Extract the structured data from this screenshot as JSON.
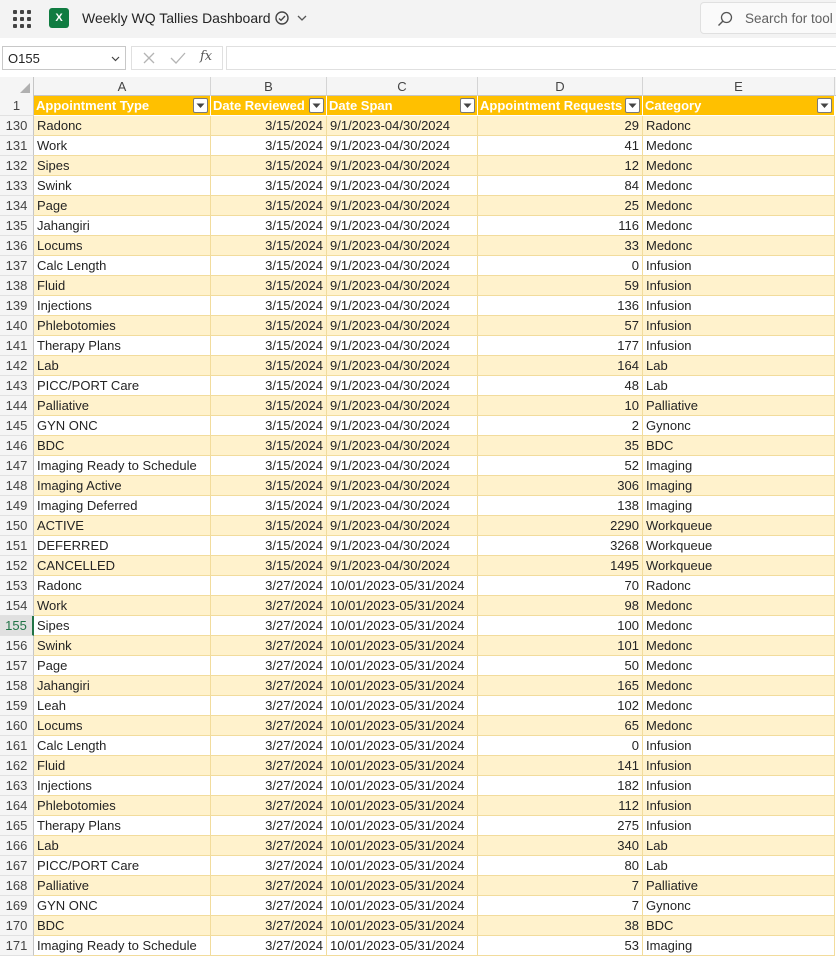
{
  "app": {
    "title": "Weekly WQ Tallies Dashboard",
    "logo_letter": "X",
    "search_placeholder": "Search for tool"
  },
  "formula_bar": {
    "name_box": "O155",
    "formula": ""
  },
  "columns": [
    "A",
    "B",
    "C",
    "D",
    "E"
  ],
  "header_row": {
    "num": "1",
    "cells": [
      "Appointment Type",
      "Date Reviewed",
      "Date Span",
      "Appointment Requests",
      "Category"
    ]
  },
  "rows": [
    {
      "num": "130",
      "cells": [
        "Radonc",
        "3/15/2024",
        "9/1/2023-04/30/2024",
        "29",
        "Radonc"
      ]
    },
    {
      "num": "131",
      "cells": [
        "Work",
        "3/15/2024",
        "9/1/2023-04/30/2024",
        "41",
        "Medonc"
      ]
    },
    {
      "num": "132",
      "cells": [
        "Sipes",
        "3/15/2024",
        "9/1/2023-04/30/2024",
        "12",
        "Medonc"
      ]
    },
    {
      "num": "133",
      "cells": [
        "Swink",
        "3/15/2024",
        "9/1/2023-04/30/2024",
        "84",
        "Medonc"
      ]
    },
    {
      "num": "134",
      "cells": [
        "Page",
        "3/15/2024",
        "9/1/2023-04/30/2024",
        "25",
        "Medonc"
      ]
    },
    {
      "num": "135",
      "cells": [
        "Jahangiri",
        "3/15/2024",
        "9/1/2023-04/30/2024",
        "116",
        "Medonc"
      ]
    },
    {
      "num": "136",
      "cells": [
        "Locums",
        "3/15/2024",
        "9/1/2023-04/30/2024",
        "33",
        "Medonc"
      ]
    },
    {
      "num": "137",
      "cells": [
        "Calc Length",
        "3/15/2024",
        "9/1/2023-04/30/2024",
        "0",
        "Infusion"
      ]
    },
    {
      "num": "138",
      "cells": [
        "Fluid",
        "3/15/2024",
        "9/1/2023-04/30/2024",
        "59",
        "Infusion"
      ]
    },
    {
      "num": "139",
      "cells": [
        "Injections",
        "3/15/2024",
        "9/1/2023-04/30/2024",
        "136",
        "Infusion"
      ]
    },
    {
      "num": "140",
      "cells": [
        "Phlebotomies",
        "3/15/2024",
        "9/1/2023-04/30/2024",
        "57",
        "Infusion"
      ]
    },
    {
      "num": "141",
      "cells": [
        "Therapy Plans",
        "3/15/2024",
        "9/1/2023-04/30/2024",
        "177",
        "Infusion"
      ]
    },
    {
      "num": "142",
      "cells": [
        "Lab",
        "3/15/2024",
        "9/1/2023-04/30/2024",
        "164",
        "Lab"
      ]
    },
    {
      "num": "143",
      "cells": [
        "PICC/PORT Care",
        "3/15/2024",
        "9/1/2023-04/30/2024",
        "48",
        "Lab"
      ]
    },
    {
      "num": "144",
      "cells": [
        "Palliative",
        "3/15/2024",
        "9/1/2023-04/30/2024",
        "10",
        "Palliative"
      ]
    },
    {
      "num": "145",
      "cells": [
        "GYN ONC",
        "3/15/2024",
        "9/1/2023-04/30/2024",
        "2",
        "Gynonc"
      ]
    },
    {
      "num": "146",
      "cells": [
        "BDC",
        "3/15/2024",
        "9/1/2023-04/30/2024",
        "35",
        "BDC"
      ]
    },
    {
      "num": "147",
      "cells": [
        "Imaging Ready to Schedule",
        "3/15/2024",
        "9/1/2023-04/30/2024",
        "52",
        "Imaging"
      ]
    },
    {
      "num": "148",
      "cells": [
        "Imaging Active",
        "3/15/2024",
        "9/1/2023-04/30/2024",
        "306",
        "Imaging"
      ]
    },
    {
      "num": "149",
      "cells": [
        "Imaging Deferred",
        "3/15/2024",
        "9/1/2023-04/30/2024",
        "138",
        "Imaging"
      ]
    },
    {
      "num": "150",
      "cells": [
        "ACTIVE",
        "3/15/2024",
        "9/1/2023-04/30/2024",
        "2290",
        "Workqueue"
      ]
    },
    {
      "num": "151",
      "cells": [
        "DEFERRED",
        "3/15/2024",
        "9/1/2023-04/30/2024",
        "3268",
        "Workqueue"
      ]
    },
    {
      "num": "152",
      "cells": [
        "CANCELLED",
        "3/15/2024",
        "9/1/2023-04/30/2024",
        "1495",
        "Workqueue"
      ]
    },
    {
      "num": "153",
      "cells": [
        "Radonc",
        "3/27/2024",
        "10/01/2023-05/31/2024",
        "70",
        "Radonc"
      ]
    },
    {
      "num": "154",
      "cells": [
        "Work",
        "3/27/2024",
        "10/01/2023-05/31/2024",
        "98",
        "Medonc"
      ]
    },
    {
      "num": "155",
      "cells": [
        "Sipes",
        "3/27/2024",
        "10/01/2023-05/31/2024",
        "100",
        "Medonc"
      ]
    },
    {
      "num": "156",
      "cells": [
        "Swink",
        "3/27/2024",
        "10/01/2023-05/31/2024",
        "101",
        "Medonc"
      ]
    },
    {
      "num": "157",
      "cells": [
        "Page",
        "3/27/2024",
        "10/01/2023-05/31/2024",
        "50",
        "Medonc"
      ]
    },
    {
      "num": "158",
      "cells": [
        "Jahangiri",
        "3/27/2024",
        "10/01/2023-05/31/2024",
        "165",
        "Medonc"
      ]
    },
    {
      "num": "159",
      "cells": [
        "Leah",
        "3/27/2024",
        "10/01/2023-05/31/2024",
        "102",
        "Medonc"
      ]
    },
    {
      "num": "160",
      "cells": [
        "Locums",
        "3/27/2024",
        "10/01/2023-05/31/2024",
        "65",
        "Medonc"
      ]
    },
    {
      "num": "161",
      "cells": [
        "Calc Length",
        "3/27/2024",
        "10/01/2023-05/31/2024",
        "0",
        "Infusion"
      ]
    },
    {
      "num": "162",
      "cells": [
        "Fluid",
        "3/27/2024",
        "10/01/2023-05/31/2024",
        "141",
        "Infusion"
      ]
    },
    {
      "num": "163",
      "cells": [
        "Injections",
        "3/27/2024",
        "10/01/2023-05/31/2024",
        "182",
        "Infusion"
      ]
    },
    {
      "num": "164",
      "cells": [
        "Phlebotomies",
        "3/27/2024",
        "10/01/2023-05/31/2024",
        "112",
        "Infusion"
      ]
    },
    {
      "num": "165",
      "cells": [
        "Therapy Plans",
        "3/27/2024",
        "10/01/2023-05/31/2024",
        "275",
        "Infusion"
      ]
    },
    {
      "num": "166",
      "cells": [
        "Lab",
        "3/27/2024",
        "10/01/2023-05/31/2024",
        "340",
        "Lab"
      ]
    },
    {
      "num": "167",
      "cells": [
        "PICC/PORT Care",
        "3/27/2024",
        "10/01/2023-05/31/2024",
        "80",
        "Lab"
      ]
    },
    {
      "num": "168",
      "cells": [
        "Palliative",
        "3/27/2024",
        "10/01/2023-05/31/2024",
        "7",
        "Palliative"
      ]
    },
    {
      "num": "169",
      "cells": [
        "GYN ONC",
        "3/27/2024",
        "10/01/2023-05/31/2024",
        "7",
        "Gynonc"
      ]
    },
    {
      "num": "170",
      "cells": [
        "BDC",
        "3/27/2024",
        "10/01/2023-05/31/2024",
        "38",
        "BDC"
      ]
    },
    {
      "num": "171",
      "cells": [
        "Imaging Ready to Schedule",
        "3/27/2024",
        "10/01/2023-05/31/2024",
        "53",
        "Imaging"
      ]
    }
  ],
  "selected_row": "155",
  "colors": {
    "header_fill": "#ffc000",
    "band_fill": "#fff2cc",
    "excel_green": "#107c41"
  }
}
